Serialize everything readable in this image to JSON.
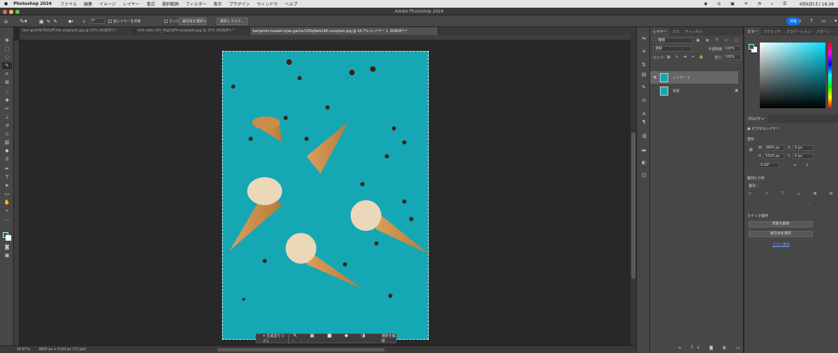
{
  "menubar": {
    "app": "Photoshop 2024",
    "items": [
      "ファイル",
      "編集",
      "イメージ",
      "レイヤー",
      "書式",
      "選択範囲",
      "フィルター",
      "表示",
      "プラグイン",
      "ウィンドウ",
      "ヘルプ"
    ],
    "clock": "4月6日(土) 18:28"
  },
  "window": {
    "title": "Adobe Photoshop 2024",
    "share": "共有"
  },
  "options": {
    "size": "0°",
    "sample_all": "全レイヤーを対象",
    "edge": "エッジを強調",
    "select_subject": "被写体を選択",
    "select_mask": "選択とマスク..."
  },
  "tabs": [
    {
      "label": "dan-gold-N7RiDzfF2iw-unsplash.jpg @ 25% (RGB/8*) *"
    },
    {
      "label": "erik-odiin-OH_tAgZkJP4-unsplash.jpg @ 25% (RGB/8*) *"
    },
    {
      "label": "benjamin-hazael-rojas-garcia-VZ9zj9wk2AE-unsplash.jpg @ 16.7% (レイヤー 1, RGB/8*) *"
    }
  ],
  "status": {
    "zoom": "16.67%",
    "info": "3800 px x 5320 px (72 ppi)"
  },
  "contextbar": {
    "generative_fill": "生成塗りつぶし",
    "deselect": "選択を解除"
  },
  "layers_panel": {
    "tabs": [
      "レイヤー",
      "パス",
      "チャンネル"
    ],
    "kind": "種類",
    "blend": "通常",
    "opacity_label": "不透明度:",
    "opacity": "100%",
    "lock_label": "ロック:",
    "fill_label": "塗り:",
    "fill": "100%",
    "layers": [
      {
        "name": "レイヤー 1"
      },
      {
        "name": "背景"
      }
    ]
  },
  "color_panel": {
    "tabs": [
      "カラー",
      "スウォッチ",
      "グラデーション",
      "パターン"
    ],
    "fg": "#0d6b73",
    "bg": "#ffffff"
  },
  "properties": {
    "tab": "プロパティ",
    "type": "ピクセルレイヤー",
    "transform": "変形",
    "w_label": "W",
    "w": "3800 px",
    "h_label": "H",
    "h": "5320 px",
    "x_label": "X",
    "x": "0 px",
    "y_label": "Y",
    "y": "0 px",
    "angle": "0.00°",
    "align": "整列と分布",
    "align_sub": "整列 :",
    "quick": "クイック操作",
    "remove_bg": "背景を削除",
    "select_subject": "被写体を選択",
    "more": "さらに表示"
  },
  "colors": {
    "accent": "#1473e6",
    "canvas": "#16a7b5"
  }
}
